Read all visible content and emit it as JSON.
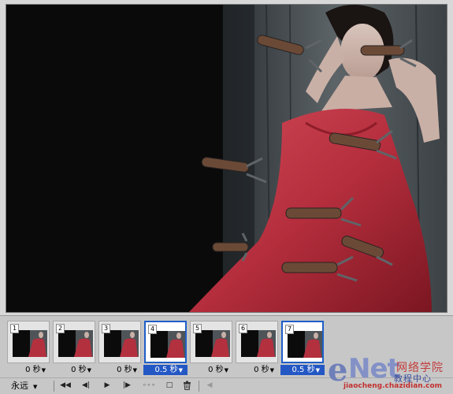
{
  "canvas": {
    "image_desc_icon": "photo-canvas"
  },
  "frames": [
    {
      "number": "1",
      "delay": "0 秒",
      "selected": false
    },
    {
      "number": "2",
      "delay": "0 秒",
      "selected": false
    },
    {
      "number": "3",
      "delay": "0 秒",
      "selected": false
    },
    {
      "number": "4",
      "delay": "0.5 秒",
      "selected": true
    },
    {
      "number": "5",
      "delay": "0 秒",
      "selected": false
    },
    {
      "number": "6",
      "delay": "0 秒",
      "selected": false
    },
    {
      "number": "7",
      "delay": "0.5 秒",
      "selected": true
    }
  ],
  "toolbar": {
    "loop_option": "永远",
    "first_frame": "◀◀",
    "prev_frame": "◀|",
    "play": "▶",
    "next_frame": "|▶",
    "tween": "∘∘∘",
    "new_frame": "□",
    "delete_frame": "🗑",
    "scroll_left": "◀"
  },
  "watermark": {
    "e_letter": "e",
    "brand": "Net",
    "cn_top": "网络学院",
    "cn_bottom": "教程中心",
    "url": "jiaocheng.chazidian.com"
  },
  "colors": {
    "selection": "#2357c4",
    "panel": "#c7c7c7",
    "dress": "#b8313f"
  }
}
